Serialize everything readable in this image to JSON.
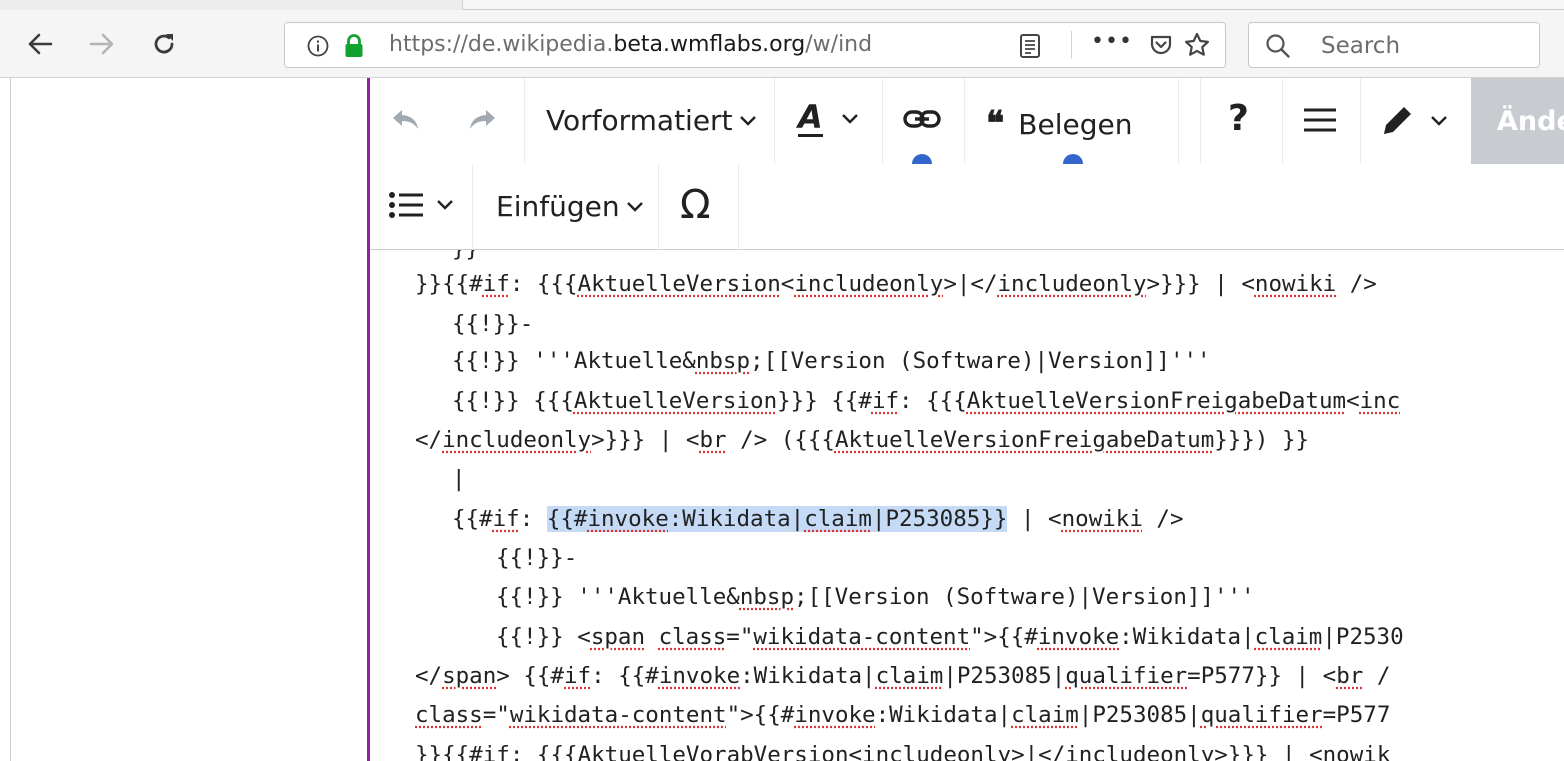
{
  "browser": {
    "url": {
      "prefix": "https://de.wikipedia.",
      "domain": "beta.wmflabs.org",
      "path": "/w/ind"
    },
    "more_label": "•••",
    "search_placeholder": "Search"
  },
  "toolbar": {
    "paragraph_format_label": "Vorformatiert",
    "cite_label": "Belegen",
    "help_label": "?",
    "save_label": "Ände",
    "insert_label": "Einfügen",
    "special_chars_label": "Ω",
    "text_style_label": "A"
  },
  "colors": {
    "editor_border": "#9a1fa0",
    "dot_blue": "#3366cc",
    "highlight": "#c5dbf5",
    "save_button_bg": "#c8ccd1"
  },
  "code_lines": [
    "}}",
    "}}{{#if: {{{AktuelleVersion<includeonly>|</includeonly>}}} | <nowiki />",
    "{{!}}-",
    "{{!}} '''Aktuelle&nbsp;[[Version (Software)|Version]]'''",
    "{{!}} {{{AktuelleVersion}}} {{#if: {{{AktuelleVersionFreigabeDatum<inc",
    "</includeonly>}}} | <br /> ({{{AktuelleVersionFreigabeDatum}}}) }}",
    "|",
    "{{#if: {{#invoke:Wikidata|claim|P253085}} | <nowiki />",
    "{{!}}-",
    "{{!}} '''Aktuelle&nbsp;[[Version (Software)|Version]]'''",
    "{{!}} <span class=\"wikidata-content\">{{#invoke:Wikidata|claim|P2530",
    "</span> {{#if: {{#invoke:Wikidata|claim|P253085|qualifier=P577}} | <br /",
    "class=\"wikidata-content\">{{#invoke:Wikidata|claim|P253085|qualifier=P577",
    "}}{{#if: {{{AktuelleVorabVersion<includeonly>|</includeonly>}}} | <nowik"
  ]
}
